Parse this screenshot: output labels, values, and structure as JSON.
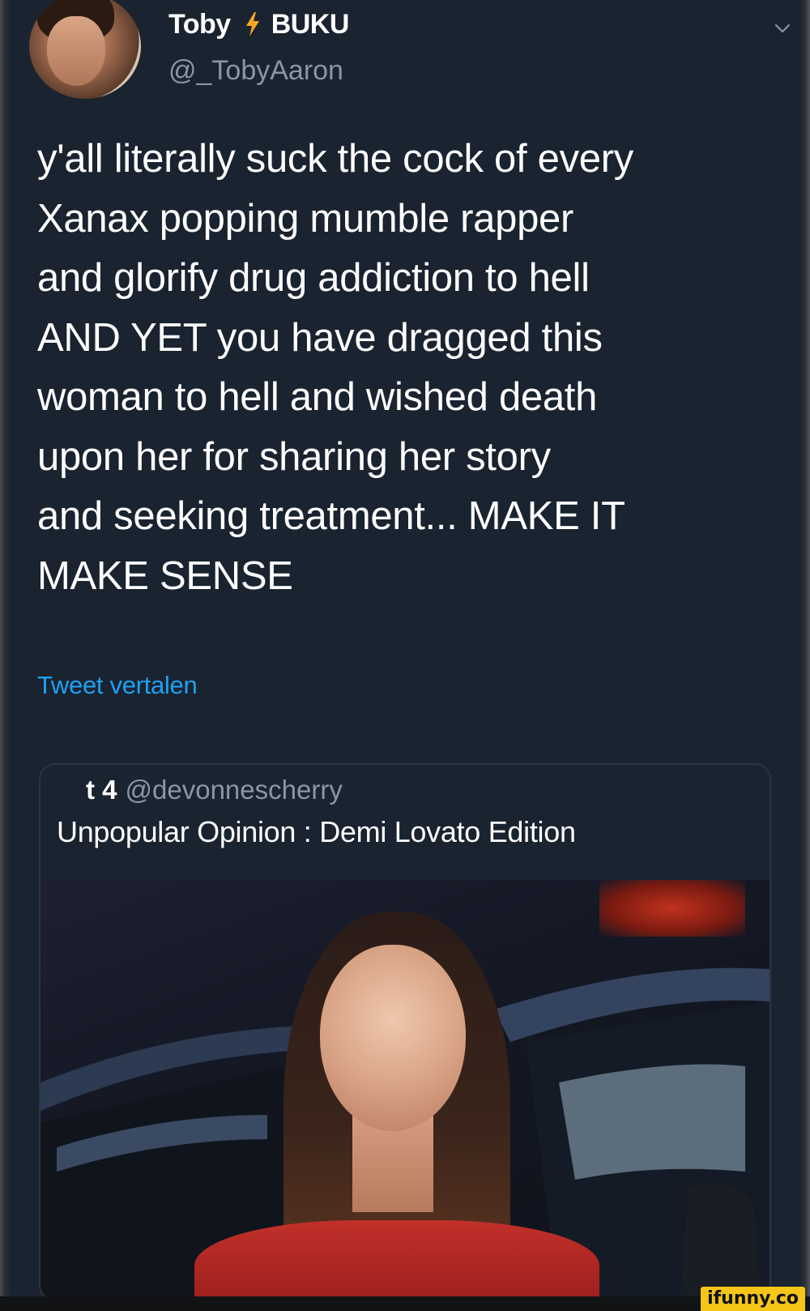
{
  "tweet": {
    "display_name_first": "Toby",
    "display_name_second": "BUKU",
    "name_separator_icon": "lightning-bolt-icon",
    "handle": "@_TobyAaron",
    "text": "y'all literally suck the cock of every\nXanax popping mumble rapper\nand glorify drug addiction to hell\nAND YET you have dragged this\nwoman to hell and wished death\nupon her for sharing her story\nand seeking treatment... MAKE IT\nMAKE SENSE",
    "translate_label": "Tweet vertalen",
    "menu_icon": "chevron-down-icon"
  },
  "quoted_tweet": {
    "name": "t 4",
    "handle": "@devonnescherry",
    "text": "Unpopular Opinion : Demi Lovato Edition"
  },
  "watermark": {
    "text": "ifunny.co"
  },
  "colors": {
    "background": "#1a2330",
    "accent_link": "#1da1f2",
    "secondary_text": "#8a96a3",
    "bolt": "#f5a623",
    "watermark_bg": "#f5c518"
  }
}
